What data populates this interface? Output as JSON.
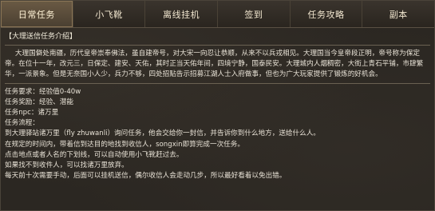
{
  "tabs": [
    {
      "label": "日常任务",
      "active": true
    },
    {
      "label": "小飞靴",
      "active": false
    },
    {
      "label": "离线挂机",
      "active": false
    },
    {
      "label": "签到",
      "active": false
    },
    {
      "label": "任务攻略",
      "active": false
    },
    {
      "label": "副本",
      "active": false
    }
  ],
  "section": {
    "title": "【大理送信任务介绍】"
  },
  "intro": "大理国僻处南疆，历代皇帝崇奉佛法，虽自建帝号，对大宋一向忍让恭顺，从来不以兵戎相见。大理国当今皇帝段正明，帝号称为保定帝。在位十一年，改元三，日保定、建安、天佑，其时正当天佑年间，四境宁静，国泰民安。大理城内人烟稠密，大街上青石平铺，市肆繁华，一派景象。但是无奈国小人少，兵力不够，四处招贴告示招募江湖人士入府做事，但也为广大玩家提供了锻炼的好机会。",
  "lines": [
    "任务要求：经验值0-40w",
    "任务奖励：经验、潜能",
    "任务npc：诸万里",
    "任务流程：",
    "到大理驿站诸万里（fly zhuwanli）询问任务，他会交给你一封信，并告诉你到什么地方，送给什么人。",
    "在规定的时间内，带着信到达目的地找到收信人，songxin即算完成一次任务。",
    "点击地点或者人名的下划线，可以自动使用小飞靴赶过去。",
    "如果找不到收件人，可以找诸万里放弃。",
    "每天前十次需要手动，后面可以挂机送信，偶尔收信人会走动几步，所以最好看着以免出错。"
  ]
}
